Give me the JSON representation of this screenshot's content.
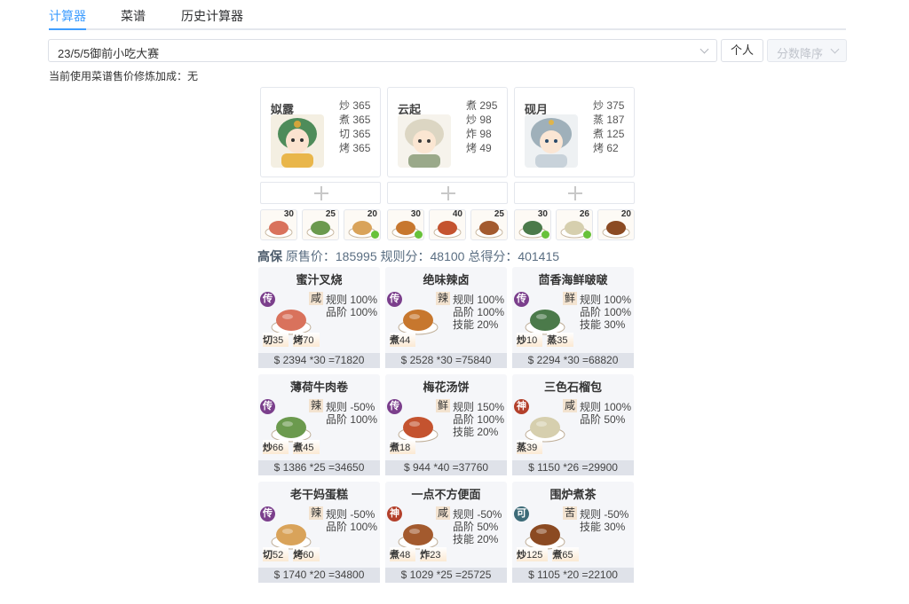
{
  "tabs": [
    {
      "label": "计算器",
      "active": true
    },
    {
      "label": "菜谱",
      "active": false
    },
    {
      "label": "历史计算器",
      "active": false
    }
  ],
  "toolbar": {
    "contest_value": "23/5/5御前小吃大赛",
    "personal_label": "个人",
    "sort_value": "分数降序"
  },
  "info_line": "当前使用菜谱售价修炼加成：无",
  "chefs": [
    {
      "name": "姒露",
      "skills": [
        {
          "k": "炒",
          "v": "365"
        },
        {
          "k": "煮",
          "v": "365"
        },
        {
          "k": "切",
          "v": "365"
        },
        {
          "k": "烤",
          "v": "365"
        }
      ],
      "avatar_color": "#6fb07a"
    },
    {
      "name": "云起",
      "skills": [
        {
          "k": "煮",
          "v": "295"
        },
        {
          "k": "炒",
          "v": "98"
        },
        {
          "k": "炸",
          "v": "98"
        },
        {
          "k": "烤",
          "v": "49"
        }
      ],
      "avatar_color": "#d9d4c4"
    },
    {
      "name": "砚月",
      "skills": [
        {
          "k": "炒",
          "v": "375"
        },
        {
          "k": "蒸",
          "v": "187"
        },
        {
          "k": "煮",
          "v": "125"
        },
        {
          "k": "烤",
          "v": "62"
        }
      ],
      "avatar_color": "#a9b8c4"
    }
  ],
  "slots": [
    {
      "qty": "30",
      "check": false
    },
    {
      "qty": "25",
      "check": false
    },
    {
      "qty": "20",
      "check": true
    },
    {
      "qty": "30",
      "check": true
    },
    {
      "qty": "40",
      "check": false
    },
    {
      "qty": "25",
      "check": false
    },
    {
      "qty": "30",
      "check": true
    },
    {
      "qty": "26",
      "check": true
    },
    {
      "qty": "20",
      "check": false
    }
  ],
  "summary": {
    "label": "高保",
    "text": "原售价：185995 规则分：48100 总得分：401415"
  },
  "dishes": [
    {
      "title": "蜜汁叉烧",
      "rarity": "传",
      "rarity_color": "#7b3f8c",
      "flavor": "咸",
      "metrics": [
        "规则 100%",
        "品阶 100%"
      ],
      "needs": [
        {
          "sk": "切",
          "v": "35"
        },
        {
          "sk": "烤",
          "v": "70"
        }
      ],
      "calc": "$ 2394 *30 =71820",
      "dish_color": "#d9725c"
    },
    {
      "title": "绝味辣卤",
      "rarity": "传",
      "rarity_color": "#7b3f8c",
      "flavor": "辣",
      "metrics": [
        "规则 100%",
        "品阶 100%",
        "技能 20%"
      ],
      "needs": [
        {
          "sk": "煮",
          "v": "44"
        }
      ],
      "calc": "$ 2528 *30 =75840",
      "dish_color": "#c7772e"
    },
    {
      "title": "茴香海鲜啵啵",
      "rarity": "传",
      "rarity_color": "#7b3f8c",
      "flavor": "鲜",
      "metrics": [
        "规则 100%",
        "品阶 100%",
        "技能 30%"
      ],
      "needs": [
        {
          "sk": "炒",
          "v": "10"
        },
        {
          "sk": "蒸",
          "v": "35"
        }
      ],
      "calc": "$ 2294 *30 =68820",
      "dish_color": "#4b7a4a"
    },
    {
      "title": "薄荷牛肉卷",
      "rarity": "传",
      "rarity_color": "#7b3f8c",
      "flavor": "辣",
      "metrics": [
        "规则 -50%",
        "品阶 100%"
      ],
      "needs": [
        {
          "sk": "炒",
          "v": "66"
        },
        {
          "sk": "煮",
          "v": "45"
        }
      ],
      "calc": "$ 1386 *25 =34650",
      "dish_color": "#6b9a4e"
    },
    {
      "title": "梅花汤饼",
      "rarity": "传",
      "rarity_color": "#7b3f8c",
      "flavor": "鲜",
      "metrics": [
        "规则 150%",
        "品阶 100%",
        "技能 20%"
      ],
      "needs": [
        {
          "sk": "煮",
          "v": "18"
        }
      ],
      "calc": "$ 944 *40 =37760",
      "dish_color": "#c4532f"
    },
    {
      "title": "三色石榴包",
      "rarity": "神",
      "rarity_color": "#b3402b",
      "flavor": "咸",
      "metrics": [
        "规则 100%",
        "品阶 50%"
      ],
      "needs": [
        {
          "sk": "蒸",
          "v": "39"
        }
      ],
      "calc": "$ 1150 *26 =29900",
      "dish_color": "#d6cfae"
    },
    {
      "title": "老干妈蛋糕",
      "rarity": "传",
      "rarity_color": "#7b3f8c",
      "flavor": "辣",
      "metrics": [
        "规则 -50%",
        "品阶 100%"
      ],
      "needs": [
        {
          "sk": "切",
          "v": "52"
        },
        {
          "sk": "烤",
          "v": "60"
        }
      ],
      "calc": "$ 1740 *20 =34800",
      "dish_color": "#d9a35a"
    },
    {
      "title": "一点不方便面",
      "rarity": "神",
      "rarity_color": "#b3402b",
      "flavor": "咸",
      "metrics": [
        "规则 -50%",
        "品阶 50%",
        "技能 20%"
      ],
      "needs": [
        {
          "sk": "煮",
          "v": "48"
        },
        {
          "sk": "炸",
          "v": "23"
        }
      ],
      "calc": "$ 1029 *25 =25725",
      "dish_color": "#a35a2e"
    },
    {
      "title": "围炉煮茶",
      "rarity": "可",
      "rarity_color": "#3d6b78",
      "flavor": "苦",
      "metrics": [
        "规则 -50%",
        "技能 30%"
      ],
      "needs": [
        {
          "sk": "炒",
          "v": "125"
        },
        {
          "sk": "煮",
          "v": "65"
        }
      ],
      "calc": "$ 1105 *20 =22100",
      "dish_color": "#8b4a22"
    }
  ]
}
